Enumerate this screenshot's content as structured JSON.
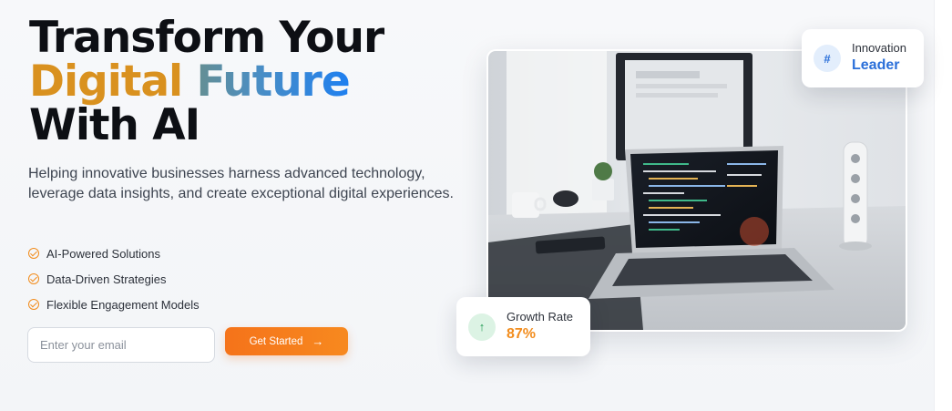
{
  "hero": {
    "headline_line1": "Transform Your",
    "headline_line2a": "Digital",
    "headline_line2b": " Future",
    "headline_line3": "With AI",
    "subtitle": "Helping innovative businesses harness advanced technology, leverage data insights, and create exceptional digital experiences.",
    "features": [
      "AI-Powered Solutions",
      "Data-Driven Strategies",
      "Flexible Engagement Models"
    ],
    "email_placeholder": "Enter your email",
    "cta_label": "Get Started",
    "cta_icon": "arrow-right-icon"
  },
  "badges": {
    "top": {
      "icon": "hash-icon",
      "label": "Innovation",
      "value": "Leader"
    },
    "bottom": {
      "icon": "arrow-up-icon",
      "label": "Growth Rate",
      "value": "87%"
    }
  },
  "colors": {
    "accent_orange": "#f5731a",
    "brand_blue": "#2a6fd9",
    "heading": "#0d0f14",
    "check": "#f28c1c"
  }
}
